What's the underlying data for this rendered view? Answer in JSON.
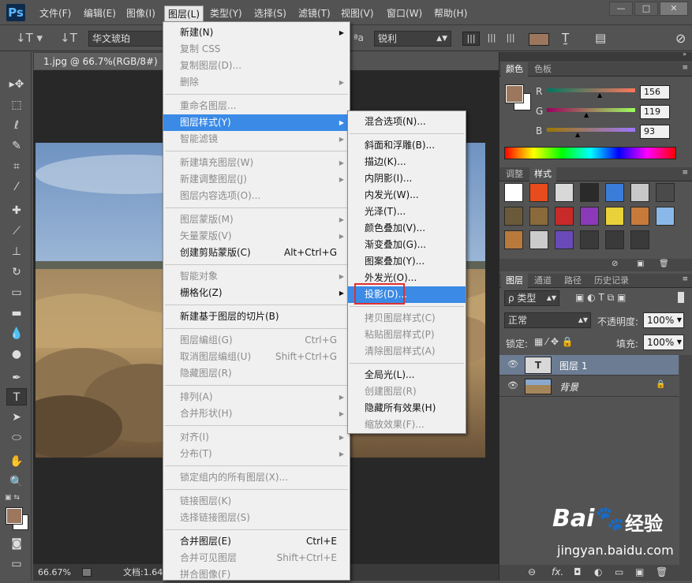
{
  "app": {
    "logo": "Ps"
  },
  "menubar": [
    {
      "label": "文件(F)"
    },
    {
      "label": "编辑(E)"
    },
    {
      "label": "图像(I)"
    },
    {
      "label": "图层(L)"
    },
    {
      "label": "类型(Y)"
    },
    {
      "label": "选择(S)"
    },
    {
      "label": "滤镜(T)"
    },
    {
      "label": "视图(V)"
    },
    {
      "label": "窗口(W)"
    },
    {
      "label": "帮助(H)"
    }
  ],
  "window_controls": {
    "minimize": "—",
    "restore": "□",
    "close": "✕"
  },
  "options": {
    "font": "华文琥珀",
    "aa_label": "ªa",
    "aa_mode": "锐利"
  },
  "document": {
    "tab": "1.jpg @ 66.7%(RGB/8#)",
    "zoom": "66.67%",
    "status": "文档:1.64"
  },
  "color_panel": {
    "tabs": [
      "颜色",
      "色板"
    ],
    "channels": [
      {
        "label": "R",
        "value": "156"
      },
      {
        "label": "G",
        "value": "119"
      },
      {
        "label": "B",
        "value": "93"
      }
    ],
    "fg": "#9c775d",
    "bg": "#ffffff"
  },
  "styles_panel": {
    "tabs": [
      "调整",
      "样式"
    ]
  },
  "layers_panel": {
    "tabs": [
      "图层",
      "通道",
      "路径",
      "历史记录"
    ],
    "filter": "ρ 类型",
    "blend": "正常",
    "opacity_label": "不透明度:",
    "opacity": "100%",
    "lock_label": "锁定:",
    "fill_label": "填充:",
    "fill": "100%",
    "layers": [
      {
        "name": "图层 1",
        "type": "text",
        "selected": true
      },
      {
        "name": "背景",
        "type": "image",
        "selected": false
      }
    ],
    "footer_fx": "fx."
  },
  "layer_menu": {
    "items": [
      {
        "label": "新建(N)",
        "submenu": true
      },
      {
        "label": "复制 CSS",
        "disabled": true
      },
      {
        "label": "复制图层(D)...",
        "disabled": true
      },
      {
        "label": "删除",
        "disabled": true,
        "submenu": true
      },
      {
        "sep": true
      },
      {
        "label": "重命名图层...",
        "disabled": true
      },
      {
        "label": "图层样式(Y)",
        "submenu": true,
        "highlight": true
      },
      {
        "label": "智能滤镜",
        "disabled": true,
        "submenu": true
      },
      {
        "sep": true
      },
      {
        "label": "新建填充图层(W)",
        "disabled": true,
        "submenu": true
      },
      {
        "label": "新建调整图层(J)",
        "disabled": true,
        "submenu": true
      },
      {
        "label": "图层内容选项(O)...",
        "disabled": true
      },
      {
        "sep": true
      },
      {
        "label": "图层蒙版(M)",
        "disabled": true,
        "submenu": true
      },
      {
        "label": "矢量蒙版(V)",
        "disabled": true,
        "submenu": true
      },
      {
        "label": "创建剪贴蒙版(C)",
        "shortcut": "Alt+Ctrl+G"
      },
      {
        "sep": true
      },
      {
        "label": "智能对象",
        "disabled": true,
        "submenu": true
      },
      {
        "label": "栅格化(Z)",
        "submenu": true
      },
      {
        "sep": true
      },
      {
        "label": "新建基于图层的切片(B)"
      },
      {
        "sep": true
      },
      {
        "label": "图层编组(G)",
        "disabled": true,
        "shortcut": "Ctrl+G"
      },
      {
        "label": "取消图层编组(U)",
        "disabled": true,
        "shortcut": "Shift+Ctrl+G"
      },
      {
        "label": "隐藏图层(R)",
        "disabled": true
      },
      {
        "sep": true
      },
      {
        "label": "排列(A)",
        "disabled": true,
        "submenu": true
      },
      {
        "label": "合并形状(H)",
        "disabled": true,
        "submenu": true
      },
      {
        "sep": true
      },
      {
        "label": "对齐(I)",
        "disabled": true,
        "submenu": true
      },
      {
        "label": "分布(T)",
        "disabled": true,
        "submenu": true
      },
      {
        "sep": true
      },
      {
        "label": "锁定组内的所有图层(X)...",
        "disabled": true
      },
      {
        "sep": true
      },
      {
        "label": "链接图层(K)",
        "disabled": true
      },
      {
        "label": "选择链接图层(S)",
        "disabled": true
      },
      {
        "sep": true
      },
      {
        "label": "合并图层(E)",
        "shortcut": "Ctrl+E"
      },
      {
        "label": "合并可见图层",
        "disabled": true,
        "shortcut": "Shift+Ctrl+E"
      },
      {
        "label": "拼合图像(F)",
        "disabled": true
      }
    ]
  },
  "style_submenu": {
    "items": [
      {
        "label": "混合选项(N)..."
      },
      {
        "sep": true
      },
      {
        "label": "斜面和浮雕(B)..."
      },
      {
        "label": "描边(K)..."
      },
      {
        "label": "内阴影(I)..."
      },
      {
        "label": "内发光(W)..."
      },
      {
        "label": "光泽(T)..."
      },
      {
        "label": "颜色叠加(V)..."
      },
      {
        "label": "渐变叠加(G)..."
      },
      {
        "label": "图案叠加(Y)..."
      },
      {
        "label": "外发光(O)..."
      },
      {
        "label": "投影(D)...",
        "highlight": true,
        "boxed": true
      },
      {
        "sep": true
      },
      {
        "label": "拷贝图层样式(C)",
        "disabled": true
      },
      {
        "label": "粘贴图层样式(P)",
        "disabled": true
      },
      {
        "label": "清除图层样式(A)",
        "disabled": true
      },
      {
        "sep": true
      },
      {
        "label": "全局光(L)..."
      },
      {
        "label": "创建图层(R)",
        "disabled": true
      },
      {
        "label": "隐藏所有效果(H)"
      },
      {
        "label": "缩放效果(F)...",
        "disabled": true
      }
    ]
  },
  "watermark": {
    "brand_a": "Bai",
    "brand_b": "经验",
    "url": "jingyan.baidu.com"
  }
}
